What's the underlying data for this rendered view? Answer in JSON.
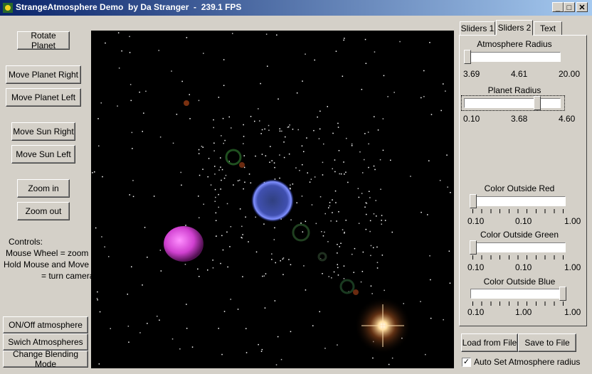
{
  "window": {
    "title": "StrangeAtmosphere Demo  by Da Stranger  -  239.1 FPS"
  },
  "buttons": {
    "rotate": "Rotate Planet",
    "move_right": "Move Planet Right",
    "move_left": "Move Planet Left",
    "sun_right": "Move Sun Right",
    "sun_left": "Move Sun Left",
    "zoom_in": "Zoom in",
    "zoom_out": "Zoom out",
    "atm_toggle": "ON/Off atmosphere",
    "switch_atm": "Swich Atmospheres",
    "blend": "Change Blending Mode",
    "load": "Load from File",
    "save": "Save to File"
  },
  "controls_help": {
    "line1": "Controls:",
    "line2": "Mouse Wheel = zoom",
    "line3": "Hold Mouse and Move =",
    "line4": "= turn camera"
  },
  "tabs": [
    "Sliders 1",
    "Sliders 2",
    "Text"
  ],
  "sliders": {
    "atmosphere_radius": {
      "label": "Atmosphere Radius",
      "min": "3.69",
      "value": "4.61",
      "max": "20.00",
      "fraction": 0.0
    },
    "planet_radius": {
      "label": "Planet Radius",
      "min": "0.10",
      "value": "3.68",
      "max": "4.60",
      "fraction": 0.78
    },
    "color_red": {
      "label": "Color Outside Red",
      "min": "0.10",
      "value": "0.10",
      "max": "1.00",
      "fraction": 0.0
    },
    "color_green": {
      "label": "Color Outside Green",
      "min": "0.10",
      "value": "0.10",
      "max": "1.00",
      "fraction": 0.0
    },
    "color_blue": {
      "label": "Color Outside Blue",
      "min": "0.10",
      "value": "1.00",
      "max": "1.00",
      "fraction": 1.0
    }
  },
  "auto_set": {
    "label": "Auto Set Atmosphere radius",
    "checked": true,
    "mark": "✓"
  },
  "titlebar_buttons": {
    "minimize": "_",
    "maximize": "□",
    "close": "✕"
  }
}
